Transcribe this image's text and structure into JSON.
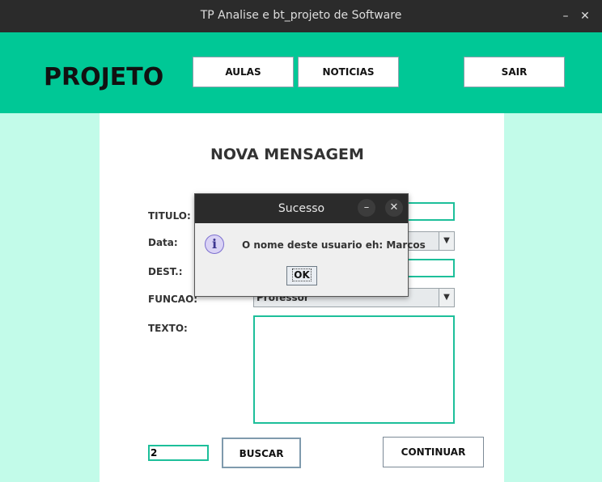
{
  "window": {
    "title": "TP Analise e bt_projeto de Software",
    "minimize_glyph": "–",
    "close_glyph": "✕"
  },
  "header": {
    "brand": "PROJETO",
    "nav": {
      "aulas": "AULAS",
      "noticias": "NOTICIAS",
      "sair": "SAIR"
    },
    "color": "#00c896"
  },
  "form": {
    "title": "NOVA MENSAGEM",
    "labels": {
      "titulo": "TITULO:",
      "data": "Data:",
      "dest": "DEST.:",
      "funcao": "FUNCAO:",
      "texto": "TEXTO:"
    },
    "funcao_value": "Professor",
    "search_value": "2",
    "buttons": {
      "buscar": "BUSCAR",
      "continuar": "CONTINUAR"
    }
  },
  "dialog": {
    "title": "Sucesso",
    "icon": "info-icon",
    "message": "O nome deste usuario eh: Marcos",
    "ok_label": "OK"
  },
  "colors": {
    "background": "#c2fbe9",
    "accent": "#00c896",
    "field_border": "#1dbf9a"
  }
}
